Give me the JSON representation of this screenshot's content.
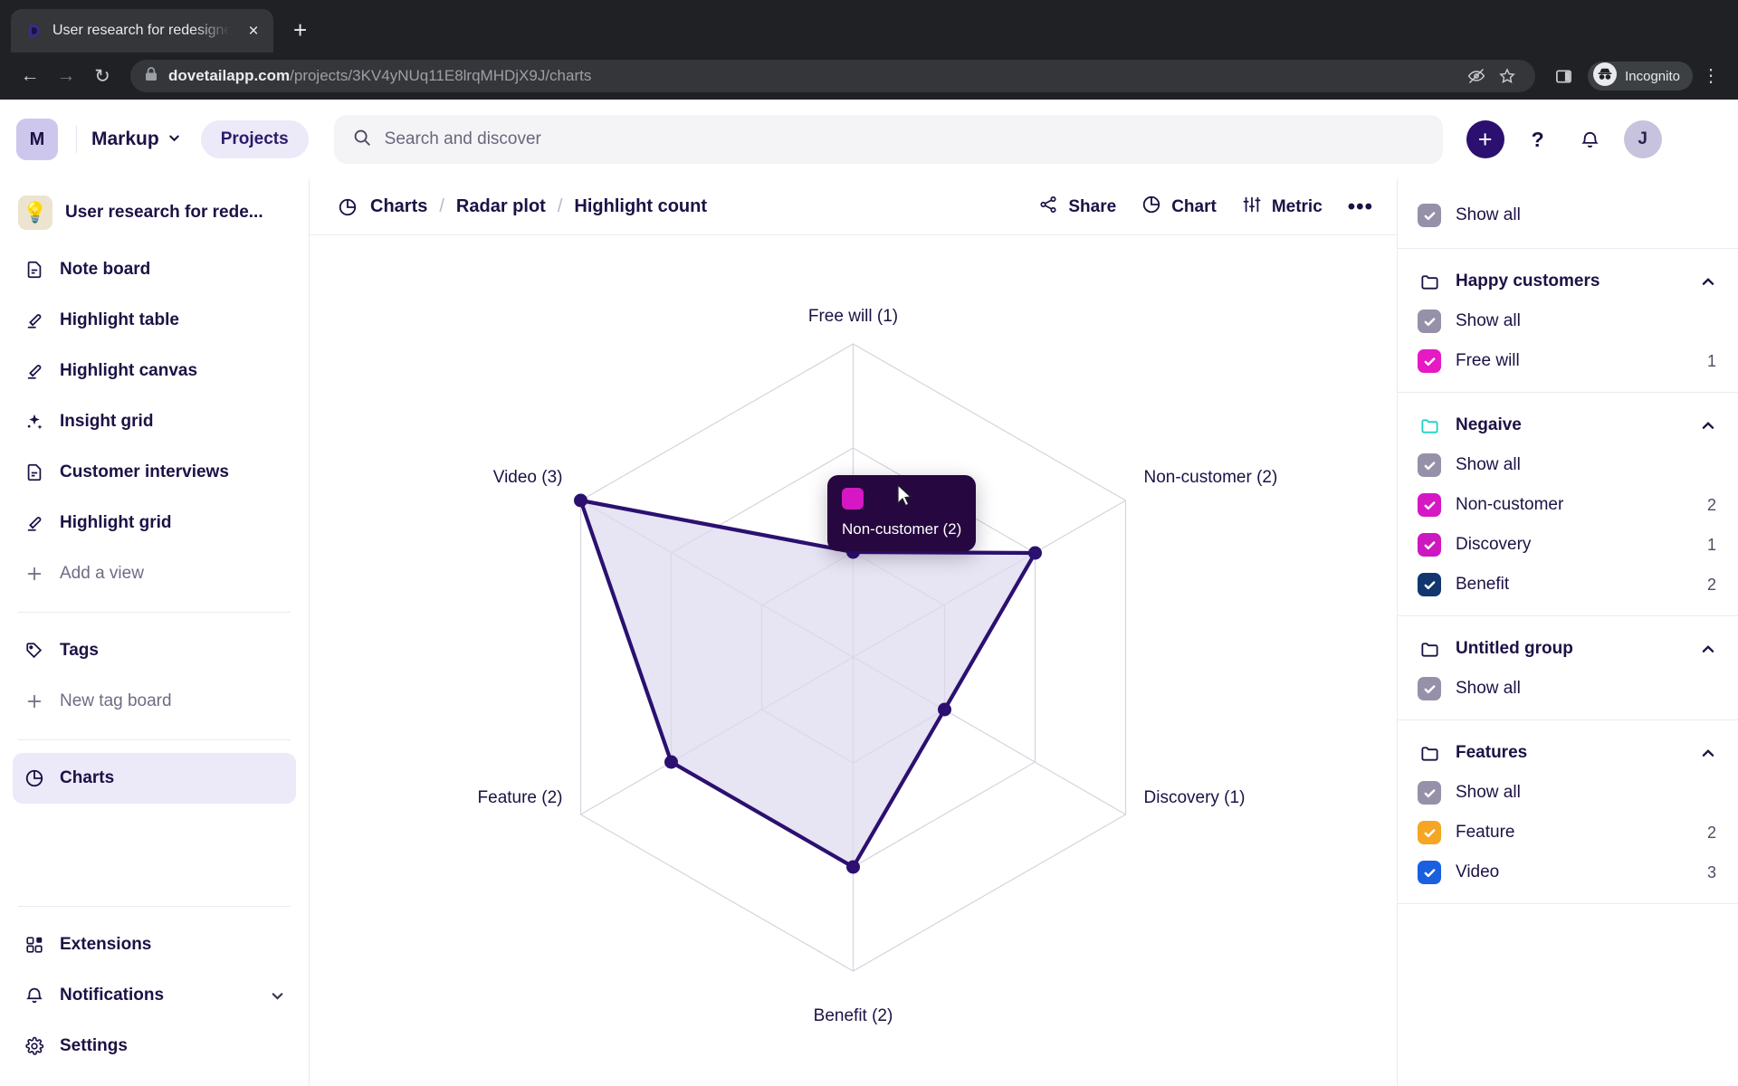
{
  "browser": {
    "tab_title": "User research for redesigned m",
    "tab_favicon_name": "dovetail-logo-icon",
    "new_tab_label": "+",
    "close_label": "×",
    "url_domain": "dovetailapp.com",
    "url_path": "/projects/3KV4yNUq11E8lrqMHDjX9J/charts",
    "incognito_label": "Incognito",
    "back_label": "←",
    "forward_label": "→",
    "reload_label": "↻",
    "menu_label": "⋮"
  },
  "header": {
    "workspace_initial": "M",
    "workspace_name": "Markup",
    "projects_label": "Projects",
    "search_placeholder": "Search and discover",
    "search_value": "",
    "create_label": "+",
    "help_label": "?",
    "user_initial": "J"
  },
  "sidebar": {
    "project_title": "User research for rede...",
    "project_emoji": "💡",
    "views": [
      {
        "label": "Note board",
        "icon": "document-icon"
      },
      {
        "label": "Highlight table",
        "icon": "highlighter-icon"
      },
      {
        "label": "Highlight canvas",
        "icon": "highlighter-icon"
      },
      {
        "label": "Insight grid",
        "icon": "sparkle-icon"
      },
      {
        "label": "Customer interviews",
        "icon": "document-icon"
      },
      {
        "label": "Highlight grid",
        "icon": "highlighter-icon"
      }
    ],
    "add_view_label": "Add a view",
    "tags_label": "Tags",
    "new_tag_board_label": "New tag board",
    "charts_label": "Charts",
    "extensions_label": "Extensions",
    "notifications_label": "Notifications",
    "settings_label": "Settings"
  },
  "toolbar": {
    "breadcrumbs": [
      "Charts",
      "Radar plot",
      "Highlight count"
    ],
    "separator": "/",
    "share_label": "Share",
    "chart_label": "Chart",
    "metric_label": "Metric",
    "more_label": "•••"
  },
  "tooltip": {
    "label": "Non-customer (2)",
    "swatch_color": "#d518c4"
  },
  "panel": {
    "show_all_label": "Show all",
    "groups": [
      {
        "name": "Happy customers",
        "folder_color": "#1d1145",
        "expanded": true,
        "show_all_label": "Show all",
        "items": [
          {
            "label": "Free will",
            "count": "1",
            "color": "#e619c3"
          }
        ]
      },
      {
        "name": "Negaive",
        "folder_color": "#17d6c6",
        "expanded": true,
        "show_all_label": "Show all",
        "items": [
          {
            "label": "Non-customer",
            "count": "2",
            "color": "#d518c4"
          },
          {
            "label": "Discovery",
            "count": "1",
            "color": "#cc19bf"
          },
          {
            "label": "Benefit",
            "count": "2",
            "color": "#11376e"
          }
        ]
      },
      {
        "name": "Untitled group",
        "folder_color": "#1d1145",
        "expanded": true,
        "show_all_label": "Show all",
        "items": []
      },
      {
        "name": "Features",
        "folder_color": "#1d1145",
        "expanded": true,
        "show_all_label": "Show all",
        "items": [
          {
            "label": "Feature",
            "count": "2",
            "color": "#f5a623"
          },
          {
            "label": "Video",
            "count": "3",
            "color": "#1a5fe0"
          }
        ]
      }
    ]
  },
  "chart_data": {
    "type": "radar",
    "title": "Highlight count",
    "categories": [
      "Free will (1)",
      "Non-customer (2)",
      "Discovery (1)",
      "Benefit (2)",
      "Feature (2)",
      "Video (3)"
    ],
    "tick_labels": [
      "Free will (1)",
      "Non-customer (2)",
      "Discovery (1)",
      "Benefit (2)",
      "Feature (2)",
      "Video (3)"
    ],
    "series": [
      {
        "name": "Highlight count",
        "values": [
          1,
          2,
          1,
          2,
          2,
          3
        ]
      }
    ],
    "rlim": [
      0,
      3
    ],
    "rings": 3,
    "grid": true,
    "legend": "none",
    "line_color": "#2b1070",
    "fill_color": "#ded9ef",
    "grid_color": "#d6d4de"
  }
}
